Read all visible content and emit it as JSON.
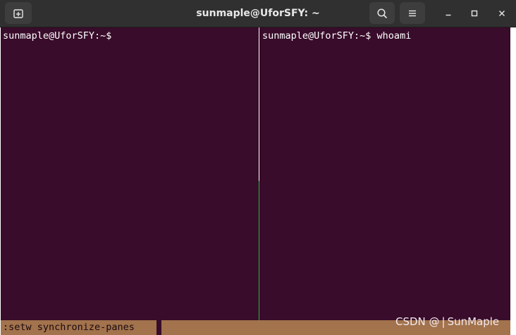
{
  "window": {
    "title": "sunmaple@UforSFY: ~"
  },
  "icons": {
    "new_tab": "new-tab-icon",
    "search": "search-icon",
    "menu": "hamburger-menu-icon",
    "minimize": "minimize-icon",
    "maximize": "maximize-icon",
    "close": "close-icon"
  },
  "colors": {
    "terminal_background": "#380c2a",
    "status_bar": "#a2734c",
    "active_pane_border": "#33b24a",
    "titlebar": "#303030"
  },
  "panes": {
    "left": {
      "line": "sunmaple@UforSFY:~$ "
    },
    "right": {
      "line": "sunmaple@UforSFY:~$ whoami"
    }
  },
  "status_bar": {
    "command": ":setw synchronize-panes"
  },
  "watermark": "CSDN @ | SunMaple"
}
